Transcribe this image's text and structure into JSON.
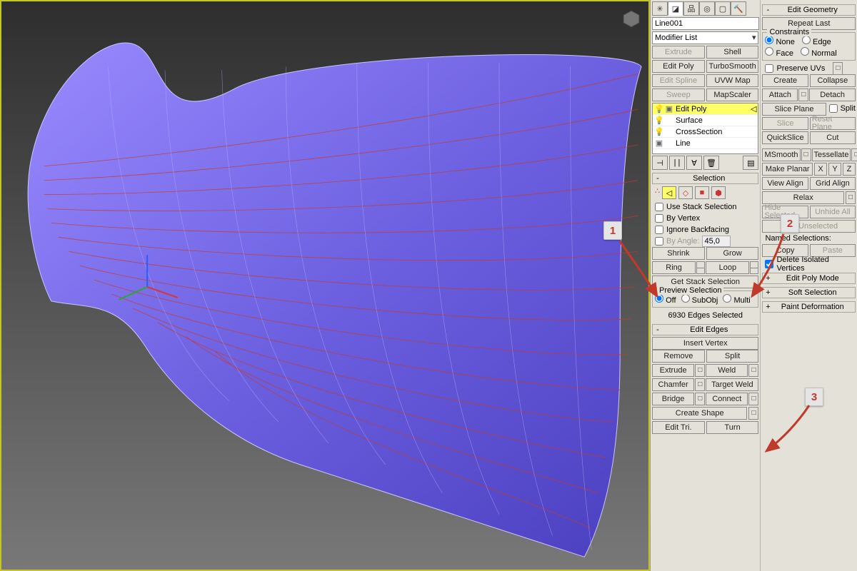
{
  "object_name": "Line001",
  "object_color": "#2929ff",
  "modifier_list_label": "Modifier List",
  "mod_buttons": {
    "extrude": "Extrude",
    "shell": "Shell",
    "edit_poly": "Edit Poly",
    "turbosmooth": "TurboSmooth",
    "edit_spline": "Edit Spline",
    "uvw_map": "UVW Map",
    "sweep": "Sweep",
    "mapscaler": "MapScaler"
  },
  "stack": [
    {
      "name": "Edit Poly",
      "selected": true,
      "edge_sub": true
    },
    {
      "name": "Surface"
    },
    {
      "name": "CrossSection"
    },
    {
      "name": "Line",
      "base": true
    }
  ],
  "selection": {
    "title": "Selection",
    "use_stack": "Use Stack Selection",
    "by_vertex": "By Vertex",
    "ignore_backfacing": "Ignore Backfacing",
    "by_angle_label": "By Angle:",
    "by_angle_value": "45,0",
    "shrink": "Shrink",
    "grow": "Grow",
    "ring": "Ring",
    "loop": "Loop",
    "get_stack_sel": "Get Stack Selection",
    "preview_legend": "Preview Selection",
    "off": "Off",
    "subobj": "SubObj",
    "multi": "Multi",
    "status": "6930 Edges Selected"
  },
  "edit_edges": {
    "title": "Edit Edges",
    "insert_vertex": "Insert Vertex",
    "remove": "Remove",
    "split": "Split",
    "extrude": "Extrude",
    "weld": "Weld",
    "chamfer": "Chamfer",
    "target_weld": "Target Weld",
    "bridge": "Bridge",
    "connect": "Connect",
    "create_shape": "Create Shape",
    "edit_tri": "Edit Tri.",
    "turn": "Turn"
  },
  "edit_geom": {
    "title": "Edit Geometry",
    "repeat_last": "Repeat Last",
    "constraints_legend": "Constraints",
    "none": "None",
    "edge": "Edge",
    "face": "Face",
    "normal": "Normal",
    "preserve_uvs": "Preserve UVs",
    "create": "Create",
    "collapse": "Collapse",
    "attach": "Attach",
    "detach": "Detach",
    "slice_plane": "Slice Plane",
    "split": "Split",
    "slice": "Slice",
    "reset_plane": "Reset Plane",
    "quickslice": "QuickSlice",
    "cut": "Cut",
    "msmooth": "MSmooth",
    "tessellate": "Tessellate",
    "make_planar": "Make Planar",
    "x": "X",
    "y": "Y",
    "z": "Z",
    "view_align": "View Align",
    "grid_align": "Grid Align",
    "relax": "Relax",
    "hide_selected": "Hide Selected",
    "unhide_all": "Unhide All",
    "hide_unselected": "Hide Unselected",
    "named_sel": "Named Selections:",
    "copy": "Copy",
    "paste": "Paste",
    "delete_iso": "Delete Isolated Vertices",
    "edit_poly_mode": "Edit Poly Mode",
    "soft_selection": "Soft Selection",
    "paint_deformation": "Paint Deformation"
  },
  "callouts": {
    "c1": "1",
    "c2": "2",
    "c3": "3"
  }
}
